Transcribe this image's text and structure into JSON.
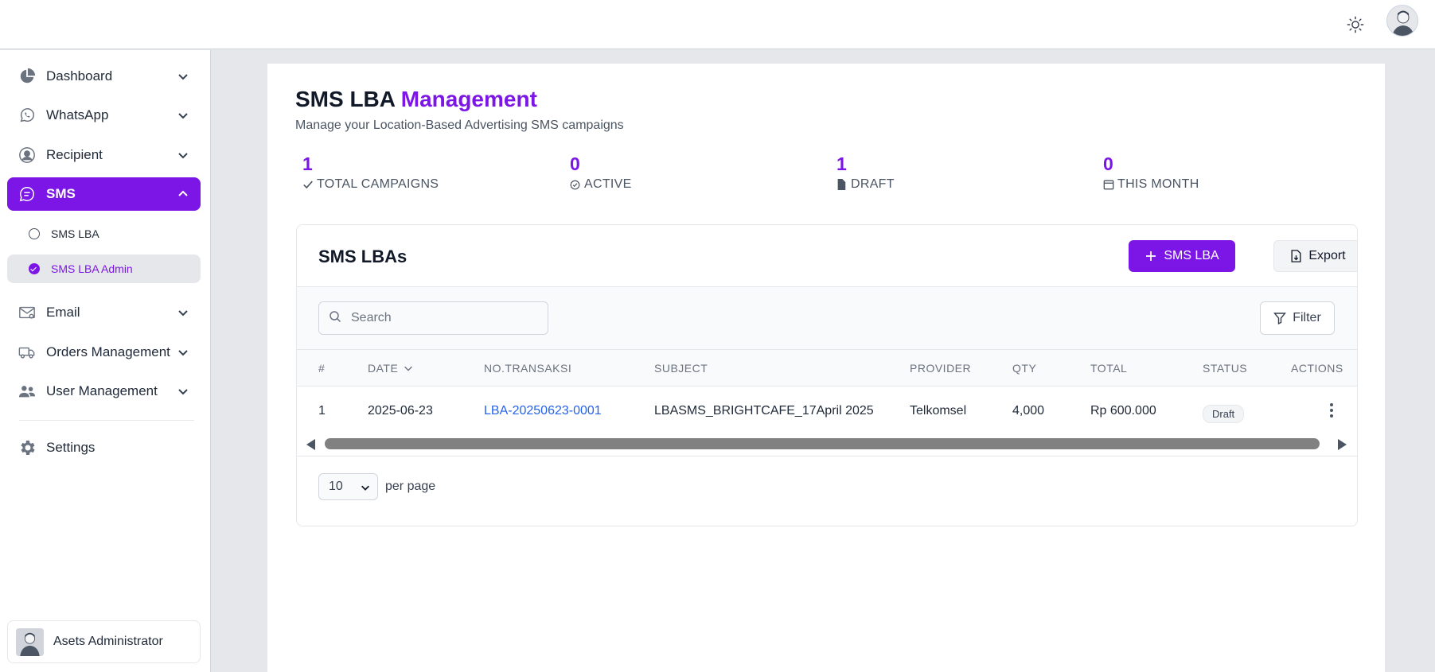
{
  "header": {
    "theme_icon": "sun-icon",
    "avatar_icon": "user-avatar"
  },
  "sidebar": {
    "items": [
      {
        "label": "Dashboard",
        "icon": "pie-chart-icon"
      },
      {
        "label": "WhatsApp",
        "icon": "whatsapp-icon"
      },
      {
        "label": "Recipient",
        "icon": "user-circle-icon"
      },
      {
        "label": "SMS",
        "icon": "chat-bubble-icon"
      },
      {
        "label": "Email",
        "icon": "envelope-icon"
      },
      {
        "label": "Orders Management",
        "icon": "truck-icon"
      },
      {
        "label": "User Management",
        "icon": "users-icon"
      },
      {
        "label": "Settings",
        "icon": "gear-icon"
      }
    ],
    "sms_sub": [
      {
        "label": "SMS LBA"
      },
      {
        "label": "SMS LBA Admin"
      }
    ],
    "user": {
      "name": "Asets Administrator"
    }
  },
  "page": {
    "title_main": "SMS LBA",
    "title_accent": "Management",
    "subtitle": "Manage your Location-Based Advertising SMS campaigns"
  },
  "stats": [
    {
      "value": "1",
      "label": "TOTAL CAMPAIGNS",
      "icon": "check-icon"
    },
    {
      "value": "0",
      "label": "ACTIVE",
      "icon": "check-circle-icon"
    },
    {
      "value": "1",
      "label": "DRAFT",
      "icon": "document-icon"
    },
    {
      "value": "0",
      "label": "THIS MONTH",
      "icon": "calendar-icon"
    }
  ],
  "card": {
    "title": "SMS LBAs",
    "add_button": "SMS LBA",
    "export_button": "Export",
    "search_placeholder": "Search",
    "filter_button": "Filter"
  },
  "table": {
    "columns": [
      "#",
      "DATE",
      "NO.TRANSAKSI",
      "SUBJECT",
      "PROVIDER",
      "QTY",
      "TOTAL",
      "STATUS",
      "ACTIONS"
    ],
    "rows": [
      {
        "no": "1",
        "date": "2025-06-23",
        "transaksi": "LBA-20250623-0001",
        "subject": "LBASMS_BRIGHTCAFE_17April 2025",
        "provider": "Telkomsel",
        "qty": "4,000",
        "total": "Rp 600.000",
        "status": "Draft"
      }
    ]
  },
  "pagination": {
    "per_page_value": "10",
    "per_page_label": "per page"
  },
  "colors": {
    "accent": "#7c16e6",
    "link": "#2563eb"
  }
}
